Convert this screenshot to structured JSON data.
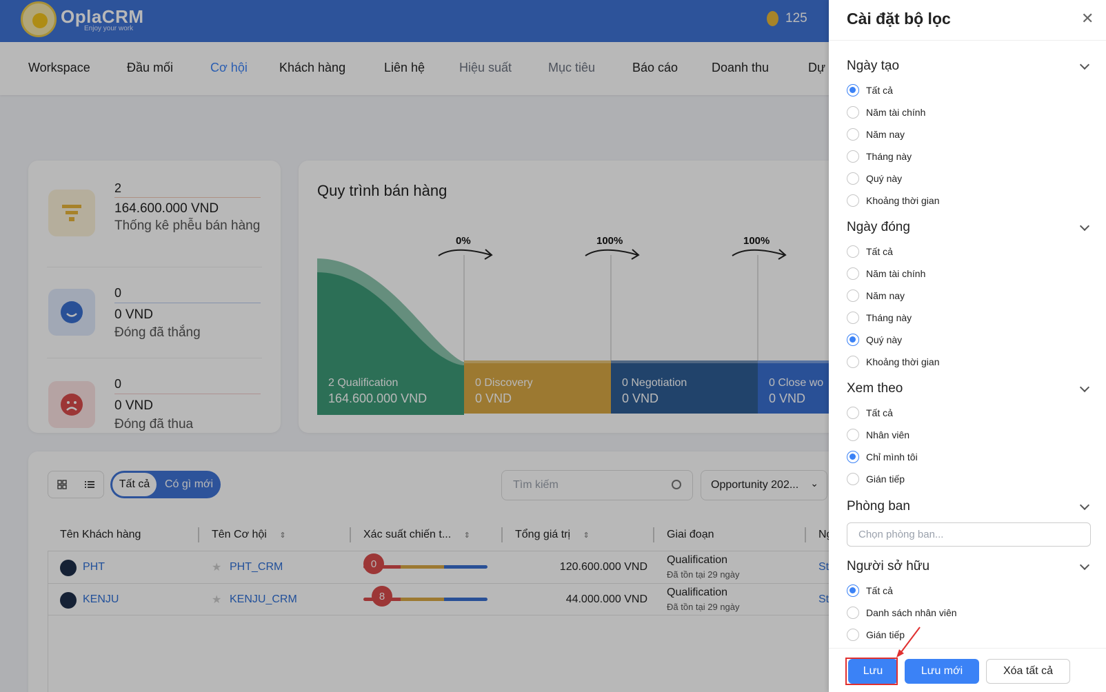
{
  "header": {
    "logo_name": "OplaCRM",
    "logo_tagline": "Enjoy your work",
    "coin_count": "125"
  },
  "nav": {
    "items": [
      "Workspace",
      "Đầu mối",
      "Cơ hội",
      "Khách hàng",
      "Liên hệ",
      "Hiệu suất",
      "Mục tiêu",
      "Báo cáo",
      "Doanh thu",
      "Dự"
    ],
    "active": "Cơ hội"
  },
  "stats": [
    {
      "count": "2",
      "amount": "164.600.000 VND",
      "label": "Thống kê phễu bán hàng"
    },
    {
      "count": "0",
      "amount": "0 VND",
      "label": "Đóng đã thắng"
    },
    {
      "count": "0",
      "amount": "0 VND",
      "label": "Đóng đã thua"
    }
  ],
  "funnel": {
    "title": "Quy trình bán hàng",
    "conversions": [
      "0%",
      "100%",
      "100%"
    ],
    "stages": [
      {
        "count": "2",
        "name": "Qualification",
        "amount": "164.600.000 VND"
      },
      {
        "count": "0",
        "name": "Discovery",
        "amount": "0 VND"
      },
      {
        "count": "0",
        "name": "Negotiation",
        "amount": "0 VND"
      },
      {
        "count": "0",
        "name": "Close wo",
        "amount": "0 VND"
      }
    ]
  },
  "toolbar": {
    "filter_all": "Tất cả",
    "filter_new": "Có gì mới",
    "search_placeholder": "Tìm kiếm",
    "view_select": "Opportunity 202..."
  },
  "table": {
    "headers": [
      "Tên Khách hàng",
      "Tên Cơ hội",
      "Xác suất chiến t...",
      "Tổng giá trị",
      "Giai đoạn",
      "Ng"
    ],
    "rows": [
      {
        "customer": "PHT",
        "opportunity": "PHT_CRM",
        "probability": "0",
        "probability_value": 0,
        "total": "120.600.000 VND",
        "stage": "Qualification",
        "stage_age": "Đã tồn tại 29 ngày",
        "owner": "St"
      },
      {
        "customer": "KENJU",
        "opportunity": "KENJU_CRM",
        "probability": "8",
        "probability_value": 8,
        "total": "44.000.000 VND",
        "stage": "Qualification",
        "stage_age": "Đã tồn tại 29 ngày",
        "owner": "St"
      }
    ]
  },
  "filter_panel": {
    "title": "Cài đặt bộ lọc",
    "sections": {
      "created": {
        "title": "Ngày tạo",
        "options": [
          "Tất cả",
          "Năm tài chính",
          "Năm nay",
          "Tháng này",
          "Quý này",
          "Khoảng thời gian"
        ],
        "selected": 0
      },
      "closed": {
        "title": "Ngày đóng",
        "options": [
          "Tất cả",
          "Năm tài chính",
          "Năm nay",
          "Tháng này",
          "Quý này",
          "Khoảng thời gian"
        ],
        "selected": 4
      },
      "view_by": {
        "title": "Xem theo",
        "options": [
          "Tất cả",
          "Nhân viên",
          "Chỉ mình tôi",
          "Gián tiếp"
        ],
        "selected": 2
      },
      "department": {
        "title": "Phòng ban",
        "placeholder": "Chọn phòng ban..."
      },
      "owner": {
        "title": "Người sở hữu",
        "options": [
          "Tất cả",
          "Danh sách nhân viên",
          "Gián tiếp"
        ],
        "selected": 0
      }
    },
    "buttons": {
      "save": "Lưu",
      "save_new": "Lưu mới",
      "clear_all": "Xóa tất cả"
    }
  },
  "colors": {
    "brand": "#3f74d6",
    "accent": "#3b82f6",
    "stage_qualification": "#3d9a78",
    "stage_discovery": "#d9a845",
    "stage_negotiation": "#2f5e95",
    "stage_close": "#3a6fd0",
    "annotation": "#e03030"
  }
}
